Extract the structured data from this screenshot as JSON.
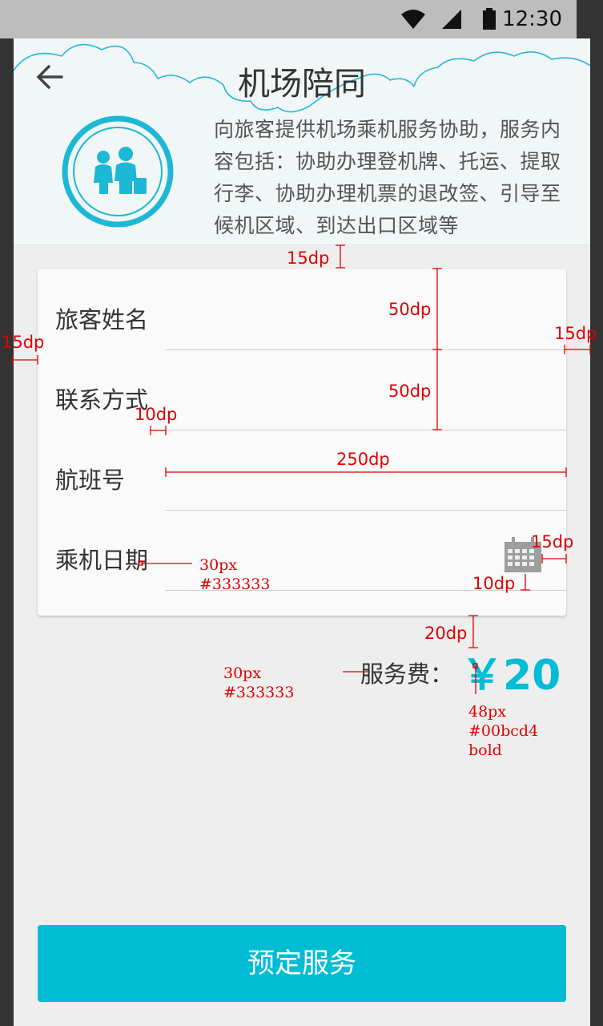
{
  "status_bar": {
    "time": "12:30"
  },
  "header": {
    "title": "机场陪同",
    "description": "向旅客提供机场乘机服务协助，服务内容包括：协助办理登机牌、托运、提取行李、协助办理机票的退改签、引导至候机区域、到达出口区域等"
  },
  "form": {
    "fields": [
      {
        "label": "旅客姓名"
      },
      {
        "label": "联系方式"
      },
      {
        "label": "航班号"
      },
      {
        "label": "乘机日期"
      }
    ]
  },
  "fee": {
    "label": "服务费：",
    "amount": "￥20"
  },
  "submit": {
    "label": "预定服务"
  },
  "annotations": {
    "gap_top": "15dp",
    "row_height_1": "50dp",
    "row_height_2": "50dp",
    "margin_left": "15dp",
    "margin_right": "15dp",
    "label_gap": "10dp",
    "field_width": "250dp",
    "cal_right": "15dp",
    "cal_bottom": "10dp",
    "fee_gap": "20dp",
    "label_font": "30px",
    "label_color": "#333333",
    "fee_font": "30px",
    "fee_color": "#333333",
    "price_font": "48px",
    "price_color": "#00bcd4",
    "price_weight": "bold"
  },
  "colors": {
    "accent": "#00bcd4",
    "text": "#333333",
    "status_bar": "#bdbdbd",
    "annotation": "#e00000"
  }
}
